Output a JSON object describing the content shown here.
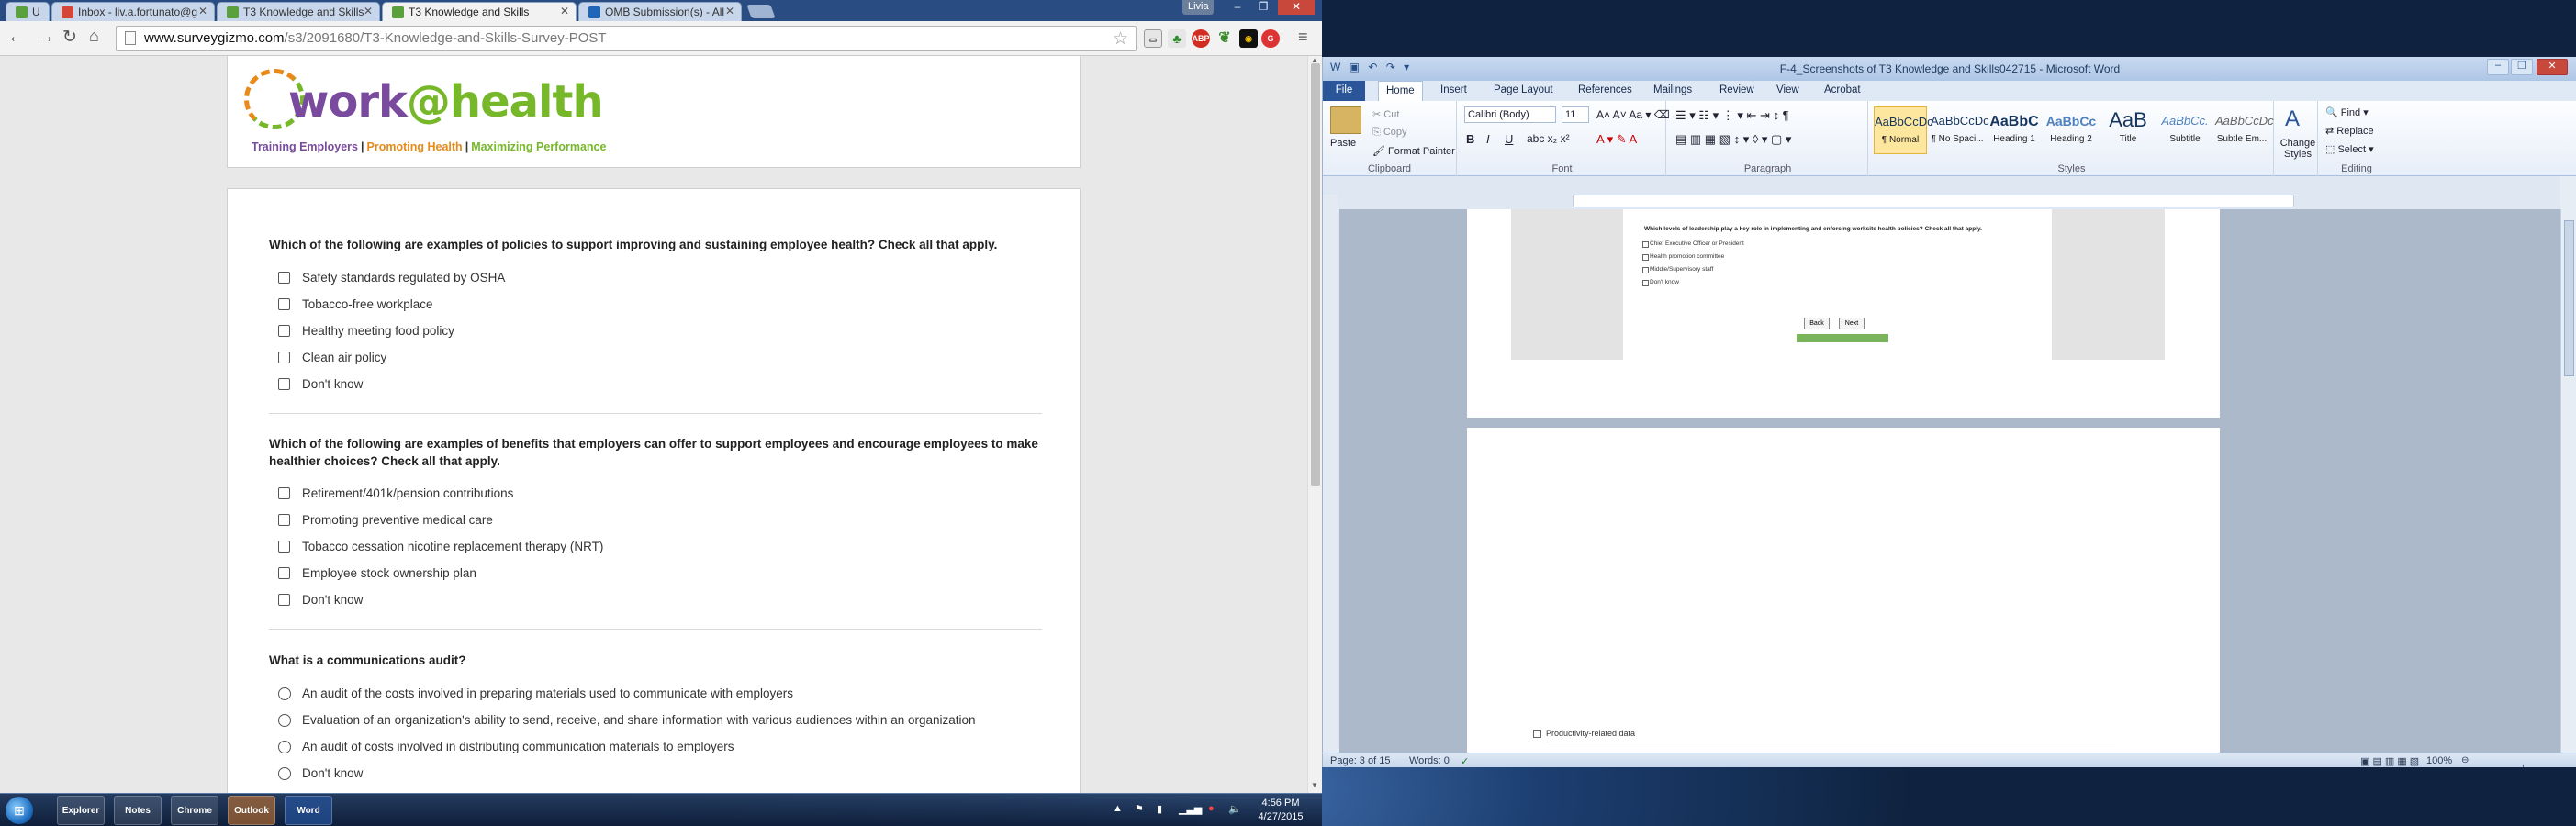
{
  "browser": {
    "tabs": [
      {
        "label": "U",
        "active": false
      },
      {
        "label": "Inbox - liv.a.fortunato@g",
        "active": false
      },
      {
        "label": "T3 Knowledge and Skills",
        "active": false
      },
      {
        "label": "T3 Knowledge and Skills",
        "active": true
      },
      {
        "label": "OMB Submission(s) - All",
        "active": false
      }
    ],
    "user": "Livia",
    "url_host": "www.surveygizmo.com",
    "url_path": "/s3/2091680/T3-Knowledge-and-Skills-Survey-POST",
    "ext_labels": [
      "ABP",
      "G"
    ]
  },
  "logo": {
    "word1": "work",
    "at": "@",
    "word2": "health",
    "tag1": "Training Employers",
    "sep": "|",
    "tag2": "Promoting Health",
    "tag3": "Maximizing Performance"
  },
  "survey": {
    "q1": {
      "text": "Which of the following are examples of policies to support improving and sustaining employee health? Check all that apply.",
      "options": [
        "Safety standards regulated by OSHA",
        "Tobacco-free workplace",
        "Healthy meeting food policy",
        "Clean air policy",
        "Don't know"
      ]
    },
    "q2": {
      "text": "Which of the following are examples of benefits that employers can offer to support employees and encourage employees to make healthier choices? Check all that apply.",
      "options": [
        "Retirement/401k/pension contributions",
        "Promoting preventive medical care",
        "Tobacco cessation nicotine replacement therapy (NRT)",
        "Employee stock ownership plan",
        "Don't know"
      ]
    },
    "q3": {
      "text": "What is a communications audit?",
      "options": [
        "An audit of the costs involved in preparing materials used to communicate with employers",
        "Evaluation of an organization's ability to send, receive, and share information with various audiences within an organization",
        "An audit of costs involved in distributing communication materials to employers",
        "Don't know"
      ]
    }
  },
  "word": {
    "title": "F-4_Screenshots of T3 Knowledge and Skills042715 - Microsoft Word",
    "tabs": [
      "File",
      "Home",
      "Insert",
      "Page Layout",
      "References",
      "Mailings",
      "Review",
      "View",
      "Acrobat"
    ],
    "clipboard": {
      "paste": "Paste",
      "cut": "Cut",
      "copy": "Copy",
      "format_painter": "Format Painter",
      "label": "Clipboard"
    },
    "font": {
      "name": "Calibri (Body)",
      "size": "11",
      "label": "Font"
    },
    "paragraph_label": "Paragraph",
    "styles": [
      {
        "sample": "AaBbCcDc",
        "name": "¶ Normal"
      },
      {
        "sample": "AaBbCcDc",
        "name": "¶ No Spaci..."
      },
      {
        "sample": "AaBbC",
        "name": "Heading 1"
      },
      {
        "sample": "AaBbCc",
        "name": "Heading 2"
      },
      {
        "sample": "AaB",
        "name": "Title"
      },
      {
        "sample": "AaBbCc.",
        "name": "Subtitle"
      },
      {
        "sample": "AaBbCcDc",
        "name": "Subtle Em..."
      }
    ],
    "styles_label": "Styles",
    "change_styles": "Change Styles",
    "editing": {
      "find": "Find",
      "replace": "Replace",
      "select": "Select",
      "label": "Editing"
    },
    "embedded": {
      "question": "Which levels of leadership play a key role in implementing and enforcing worksite health policies? Check all that apply.",
      "options": [
        "Chief Executive Officer or President",
        "Health promotion committee",
        "Middle/Supervisory staff",
        "Don't know"
      ],
      "back": "Back",
      "next": "Next"
    },
    "page2_option": "Productivity-related data",
    "status": {
      "page": "Page: 3 of 15",
      "words": "Words: 0",
      "zoom": "100%"
    }
  },
  "taskbar": {
    "apps": [
      "Explorer",
      "Notes",
      "Chrome",
      "Outlook",
      "Word"
    ],
    "time": "4:56 PM",
    "date": "4/27/2015"
  }
}
